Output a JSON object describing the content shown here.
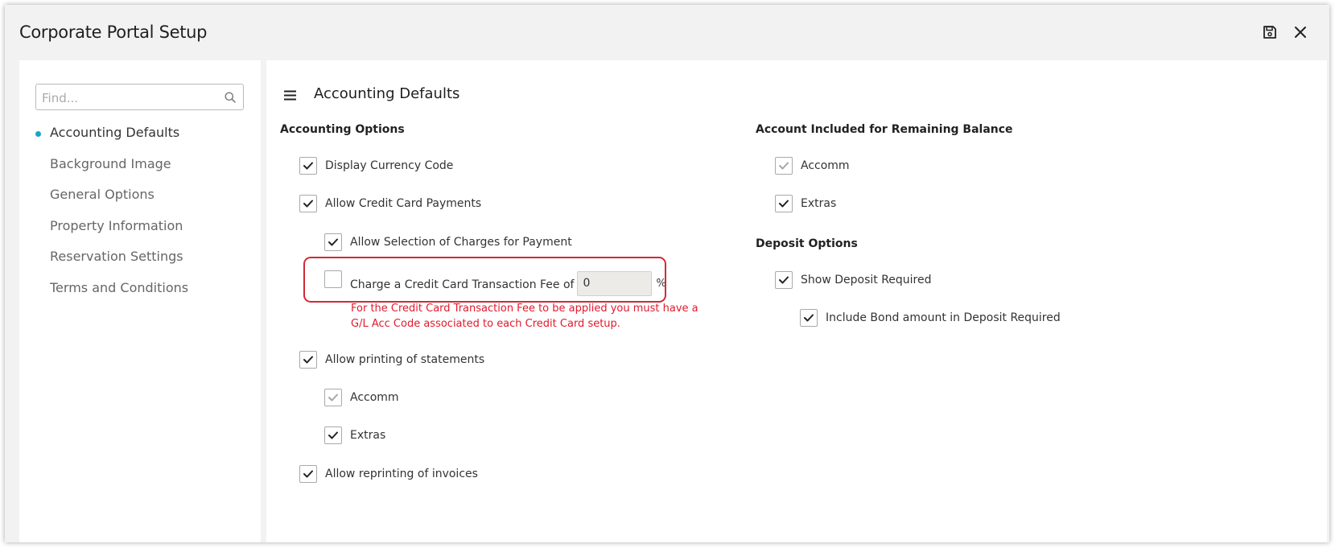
{
  "window": {
    "title": "Corporate Portal Setup"
  },
  "sidebar": {
    "search_placeholder": "Find...",
    "items": [
      {
        "label": "Accounting Defaults",
        "active": true
      },
      {
        "label": "Background Image",
        "active": false
      },
      {
        "label": "General Options",
        "active": false
      },
      {
        "label": "Property Information",
        "active": false
      },
      {
        "label": "Reservation Settings",
        "active": false
      },
      {
        "label": "Terms and Conditions",
        "active": false
      }
    ]
  },
  "main": {
    "title": "Accounting Defaults",
    "accounting_options": {
      "heading": "Accounting Options",
      "display_currency_code": {
        "label": "Display Currency Code",
        "checked": true
      },
      "allow_credit_card_payments": {
        "label": "Allow Credit Card Payments",
        "checked": true
      },
      "allow_selection_of_charges": {
        "label": "Allow Selection of Charges for Payment",
        "checked": true
      },
      "charge_cc_fee": {
        "label": "Charge a Credit Card Transaction Fee of",
        "checked": false,
        "value": "0",
        "unit": "%"
      },
      "cc_fee_warning": "For the Credit Card Transaction Fee to be applied you must have a G/L Acc Code associated to each Credit Card setup.",
      "allow_printing_statements": {
        "label": "Allow printing of statements",
        "checked": true
      },
      "statements_accomm": {
        "label": "Accomm",
        "checked": true,
        "disabled": true
      },
      "statements_extras": {
        "label": "Extras",
        "checked": true
      },
      "allow_reprinting_invoices": {
        "label": "Allow reprinting of invoices",
        "checked": true
      }
    },
    "remaining_balance": {
      "heading": "Account Included for Remaining Balance",
      "accomm": {
        "label": "Accomm",
        "checked": true,
        "disabled": true
      },
      "extras": {
        "label": "Extras",
        "checked": true
      }
    },
    "deposit_options": {
      "heading": "Deposit Options",
      "show_deposit_required": {
        "label": "Show Deposit Required",
        "checked": true
      },
      "include_bond": {
        "label": "Include Bond amount in Deposit Required",
        "checked": true
      }
    }
  },
  "colors": {
    "accent_dot": "#1aa3c8",
    "highlight_border": "#d12a35",
    "warning_text": "#e0192c",
    "check_disabled": "#a6a6a6",
    "check": "#222222"
  }
}
